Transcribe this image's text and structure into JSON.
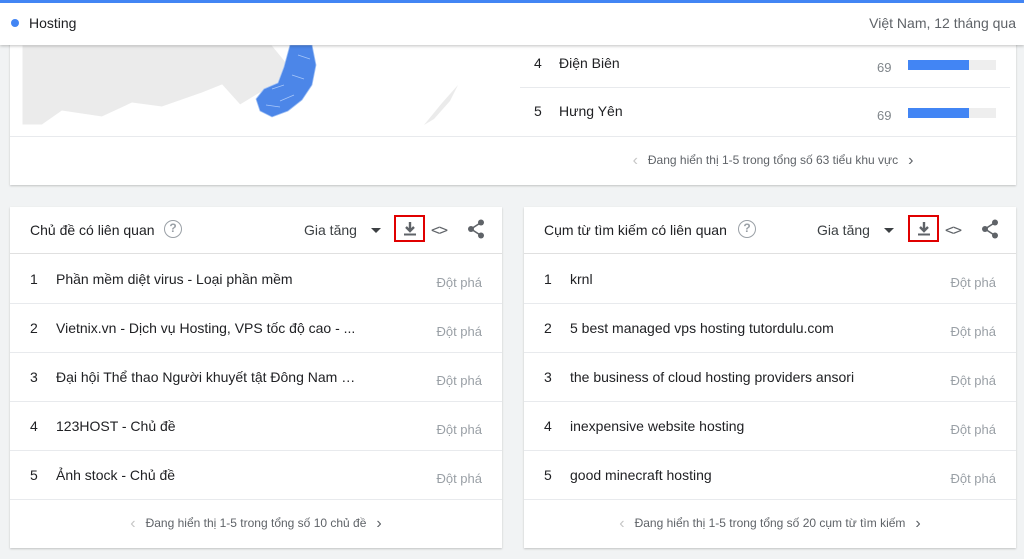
{
  "header": {
    "term": "Hosting",
    "meta": "Việt Nam, 12 tháng qua",
    "accent": "#4285f4"
  },
  "regions": {
    "rows": [
      {
        "rank": "4",
        "name": "Điện Biên",
        "value": "69",
        "level": 0.69
      },
      {
        "rank": "5",
        "name": "Hưng Yên",
        "value": "69",
        "level": 0.69
      }
    ],
    "pager": "Đang hiển thị 1-5 trong tổng số 63 tiểu khu vực"
  },
  "topics": {
    "title": "Chủ đề có liên quan",
    "sort": "Gia tăng",
    "items": [
      {
        "rank": "1",
        "text": "Phần mềm diệt virus - Loại phần mềm",
        "value": "Đột phá"
      },
      {
        "rank": "2",
        "text": "Vietnix.vn - Dịch vụ Hosting, VPS tốc độ cao - ...",
        "value": "Đột phá"
      },
      {
        "rank": "3",
        "text": "Đại hội Thể thao Người khuyết tật Đông Nam Á...",
        "value": "Đột phá"
      },
      {
        "rank": "4",
        "text": "123HOST - Chủ đề",
        "value": "Đột phá"
      },
      {
        "rank": "5",
        "text": "Ảnh stock - Chủ đề",
        "value": "Đột phá"
      }
    ],
    "pager": "Đang hiển thị 1-5 trong tổng số 10 chủ đề"
  },
  "queries": {
    "title": "Cụm từ tìm kiếm có liên quan",
    "sort": "Gia tăng",
    "items": [
      {
        "rank": "1",
        "text": "krnl",
        "value": "Đột phá"
      },
      {
        "rank": "2",
        "text": "5 best managed vps hosting tutordulu.com",
        "value": "Đột phá"
      },
      {
        "rank": "3",
        "text": "the business of cloud hosting providers ansori",
        "value": "Đột phá"
      },
      {
        "rank": "4",
        "text": "inexpensive website hosting",
        "value": "Đột phá"
      },
      {
        "rank": "5",
        "text": "good minecraft hosting",
        "value": "Đột phá"
      }
    ],
    "pager": "Đang hiển thị 1-5 trong tổng số 20 cụm từ tìm kiếm"
  },
  "colors": {
    "bar": "#4285f4",
    "highlight_box": "#e00000"
  },
  "icons": {
    "download": "download-icon",
    "embed": "embed-code-icon",
    "share": "share-icon",
    "help": "help-icon"
  }
}
